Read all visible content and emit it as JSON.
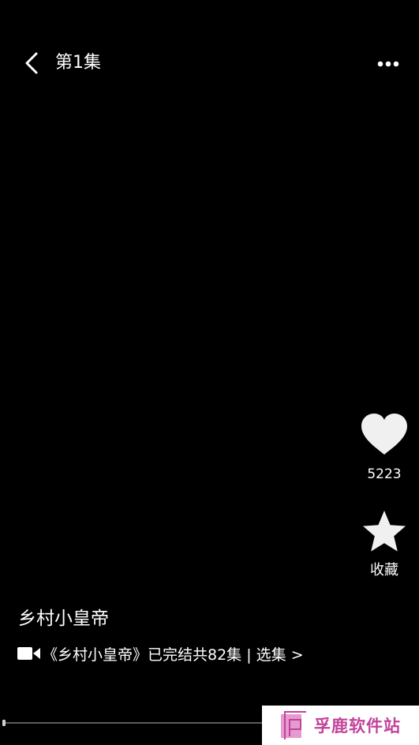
{
  "header": {
    "episode_title": "第1集"
  },
  "actions": {
    "like_count": "5223",
    "favorite_label": "收藏"
  },
  "info": {
    "show_title": "乡村小皇帝",
    "series_text": "《乡村小皇帝》已完结共82集 | 选集 >"
  },
  "player": {
    "progress_fraction": 0.0
  },
  "watermark": {
    "text": "孚鹿软件站",
    "color": "#c2439a"
  },
  "icons": {
    "back": "chevron-left-icon",
    "more": "more-dots-icon",
    "like": "heart-icon",
    "favorite": "star-icon",
    "series": "video-camera-icon"
  }
}
